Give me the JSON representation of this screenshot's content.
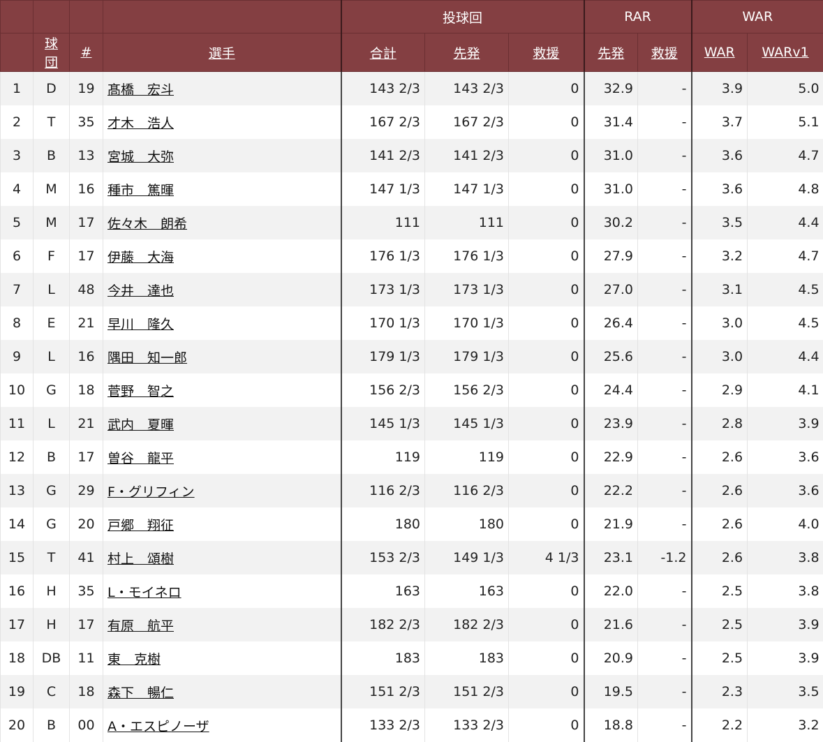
{
  "header": {
    "groups": {
      "ip": "投球回",
      "rar": "RAR",
      "war": "WAR"
    },
    "columns": {
      "team": "球団",
      "number": "#",
      "player": "選手",
      "ip_total": "合計",
      "ip_start": "先発",
      "ip_relief": "救援",
      "rar_start": "先発",
      "rar_relief": "救援",
      "war": "WAR",
      "warv1": "WARv1"
    }
  },
  "rows": [
    {
      "rank": "1",
      "team": "D",
      "num": "19",
      "name": "髙橋　宏斗",
      "ip_total": "143 2/3",
      "ip_start": "143 2/3",
      "ip_relief": "0",
      "rar_start": "32.9",
      "rar_relief": "-",
      "war": "3.9",
      "warv1": "5.0"
    },
    {
      "rank": "2",
      "team": "T",
      "num": "35",
      "name": "才木　浩人",
      "ip_total": "167 2/3",
      "ip_start": "167 2/3",
      "ip_relief": "0",
      "rar_start": "31.4",
      "rar_relief": "-",
      "war": "3.7",
      "warv1": "5.1"
    },
    {
      "rank": "3",
      "team": "B",
      "num": "13",
      "name": "宮城　大弥",
      "ip_total": "141 2/3",
      "ip_start": "141 2/3",
      "ip_relief": "0",
      "rar_start": "31.0",
      "rar_relief": "-",
      "war": "3.6",
      "warv1": "4.7"
    },
    {
      "rank": "4",
      "team": "M",
      "num": "16",
      "name": "種市　篤暉",
      "ip_total": "147 1/3",
      "ip_start": "147 1/3",
      "ip_relief": "0",
      "rar_start": "31.0",
      "rar_relief": "-",
      "war": "3.6",
      "warv1": "4.8"
    },
    {
      "rank": "5",
      "team": "M",
      "num": "17",
      "name": "佐々木　朗希",
      "ip_total": "111",
      "ip_start": "111",
      "ip_relief": "0",
      "rar_start": "30.2",
      "rar_relief": "-",
      "war": "3.5",
      "warv1": "4.4"
    },
    {
      "rank": "6",
      "team": "F",
      "num": "17",
      "name": "伊藤　大海",
      "ip_total": "176 1/3",
      "ip_start": "176 1/3",
      "ip_relief": "0",
      "rar_start": "27.9",
      "rar_relief": "-",
      "war": "3.2",
      "warv1": "4.7"
    },
    {
      "rank": "7",
      "team": "L",
      "num": "48",
      "name": "今井　達也",
      "ip_total": "173 1/3",
      "ip_start": "173 1/3",
      "ip_relief": "0",
      "rar_start": "27.0",
      "rar_relief": "-",
      "war": "3.1",
      "warv1": "4.5"
    },
    {
      "rank": "8",
      "team": "E",
      "num": "21",
      "name": "早川　隆久",
      "ip_total": "170 1/3",
      "ip_start": "170 1/3",
      "ip_relief": "0",
      "rar_start": "26.4",
      "rar_relief": "-",
      "war": "3.0",
      "warv1": "4.5"
    },
    {
      "rank": "9",
      "team": "L",
      "num": "16",
      "name": "隅田　知一郎",
      "ip_total": "179 1/3",
      "ip_start": "179 1/3",
      "ip_relief": "0",
      "rar_start": "25.6",
      "rar_relief": "-",
      "war": "3.0",
      "warv1": "4.4"
    },
    {
      "rank": "10",
      "team": "G",
      "num": "18",
      "name": "菅野　智之",
      "ip_total": "156 2/3",
      "ip_start": "156 2/3",
      "ip_relief": "0",
      "rar_start": "24.4",
      "rar_relief": "-",
      "war": "2.9",
      "warv1": "4.1"
    },
    {
      "rank": "11",
      "team": "L",
      "num": "21",
      "name": "武内　夏暉",
      "ip_total": "145 1/3",
      "ip_start": "145 1/3",
      "ip_relief": "0",
      "rar_start": "23.9",
      "rar_relief": "-",
      "war": "2.8",
      "warv1": "3.9"
    },
    {
      "rank": "12",
      "team": "B",
      "num": "17",
      "name": "曽谷　龍平",
      "ip_total": "119",
      "ip_start": "119",
      "ip_relief": "0",
      "rar_start": "22.9",
      "rar_relief": "-",
      "war": "2.6",
      "warv1": "3.6"
    },
    {
      "rank": "13",
      "team": "G",
      "num": "29",
      "name": "F・グリフィン",
      "ip_total": "116 2/3",
      "ip_start": "116 2/3",
      "ip_relief": "0",
      "rar_start": "22.2",
      "rar_relief": "-",
      "war": "2.6",
      "warv1": "3.6"
    },
    {
      "rank": "14",
      "team": "G",
      "num": "20",
      "name": "戸郷　翔征",
      "ip_total": "180",
      "ip_start": "180",
      "ip_relief": "0",
      "rar_start": "21.9",
      "rar_relief": "-",
      "war": "2.6",
      "warv1": "4.0"
    },
    {
      "rank": "15",
      "team": "T",
      "num": "41",
      "name": "村上　頌樹",
      "ip_total": "153 2/3",
      "ip_start": "149 1/3",
      "ip_relief": "4 1/3",
      "rar_start": "23.1",
      "rar_relief": "-1.2",
      "war": "2.6",
      "warv1": "3.8"
    },
    {
      "rank": "16",
      "team": "H",
      "num": "35",
      "name": "L・モイネロ",
      "ip_total": "163",
      "ip_start": "163",
      "ip_relief": "0",
      "rar_start": "22.0",
      "rar_relief": "-",
      "war": "2.5",
      "warv1": "3.8"
    },
    {
      "rank": "17",
      "team": "H",
      "num": "17",
      "name": "有原　航平",
      "ip_total": "182 2/3",
      "ip_start": "182 2/3",
      "ip_relief": "0",
      "rar_start": "21.6",
      "rar_relief": "-",
      "war": "2.5",
      "warv1": "3.9"
    },
    {
      "rank": "18",
      "team": "DB",
      "num": "11",
      "name": "東　克樹",
      "ip_total": "183",
      "ip_start": "183",
      "ip_relief": "0",
      "rar_start": "20.9",
      "rar_relief": "-",
      "war": "2.5",
      "warv1": "3.9"
    },
    {
      "rank": "19",
      "team": "C",
      "num": "18",
      "name": "森下　暢仁",
      "ip_total": "151 2/3",
      "ip_start": "151 2/3",
      "ip_relief": "0",
      "rar_start": "19.5",
      "rar_relief": "-",
      "war": "2.3",
      "warv1": "3.5"
    },
    {
      "rank": "20",
      "team": "B",
      "num": "00",
      "name": "A・エスピノーザ",
      "ip_total": "133 2/3",
      "ip_start": "133 2/3",
      "ip_relief": "0",
      "rar_start": "18.8",
      "rar_relief": "-",
      "war": "2.2",
      "warv1": "3.2"
    }
  ]
}
